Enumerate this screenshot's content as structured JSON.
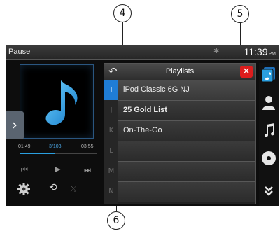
{
  "callouts": [
    "4",
    "5",
    "6"
  ],
  "status_bar": {
    "status": "Pause",
    "time": "11:39",
    "meridiem": "PM"
  },
  "player": {
    "elapsed": "01:49",
    "track_position": "3/103",
    "duration": "03:55",
    "progress_fraction": 0.46
  },
  "playlist_panel": {
    "title": "Playlists",
    "letters": [
      "I",
      "J",
      "K",
      "L",
      "M",
      "N"
    ],
    "active_letter": "I",
    "items": [
      "iPod Classic 6G NJ",
      "25 Gold List",
      "On-The-Go",
      "",
      "",
      ""
    ]
  },
  "right_bar_icons": [
    "music-library-icon",
    "artist-icon",
    "music-note-icon",
    "disc-icon",
    "more-chevron-icon"
  ],
  "colors": {
    "accent": "#1f7dd6",
    "close": "#dd1d1d",
    "background": "#0d0d0d"
  }
}
